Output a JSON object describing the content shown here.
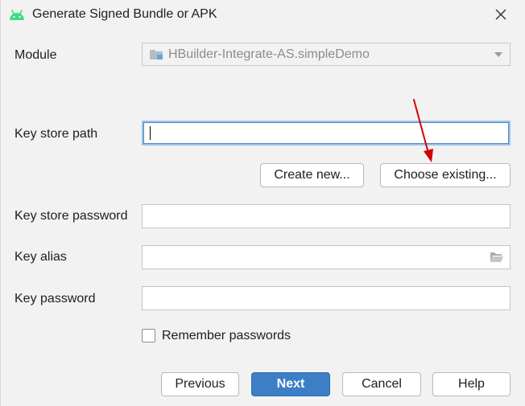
{
  "window": {
    "title": "Generate Signed Bundle or APK",
    "app_icon": "android-icon",
    "close_icon": "close-icon"
  },
  "module": {
    "label": "Module",
    "selected": "HBuilder-Integrate-AS.simpleDemo",
    "icon": "module-folder-icon"
  },
  "key_store_path": {
    "label": "Key store path",
    "value": ""
  },
  "keystore_buttons": {
    "create_new": "Create new...",
    "choose_existing": "Choose existing..."
  },
  "key_store_password": {
    "label": "Key store password",
    "value": ""
  },
  "key_alias": {
    "label": "Key alias",
    "value": "",
    "browse_icon": "folder-open-icon"
  },
  "key_password": {
    "label": "Key password",
    "value": ""
  },
  "remember_passwords": {
    "label": "Remember passwords",
    "checked": false
  },
  "footer": {
    "previous": "Previous",
    "next": "Next",
    "cancel": "Cancel",
    "help": "Help"
  },
  "colors": {
    "primary_button": "#3c7fc7",
    "focus_border": "#4a89c8",
    "annotation_arrow": "#d40000",
    "android_green": "#3ddc84"
  }
}
